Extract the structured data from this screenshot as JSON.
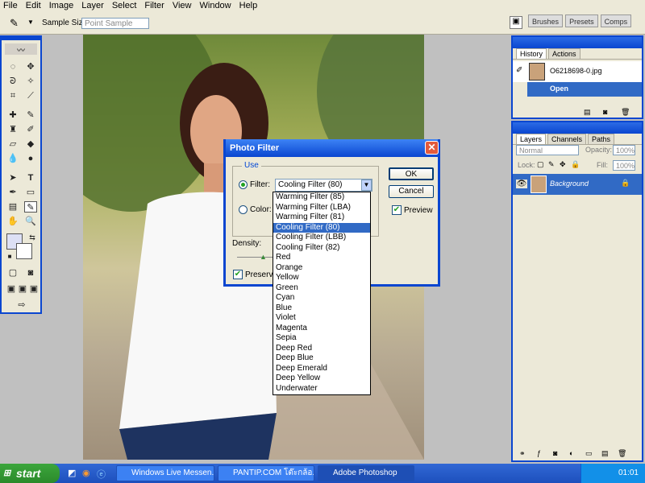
{
  "menu": [
    "File",
    "Edit",
    "Image",
    "Layer",
    "Select",
    "Filter",
    "View",
    "Window",
    "Help"
  ],
  "options": {
    "sample_size_label": "Sample Size:",
    "sample_size_value": "Point Sample"
  },
  "panel_well": {
    "tabs": [
      "Brushes",
      "Presets",
      "Comps"
    ]
  },
  "history_panel": {
    "tabs": [
      "History",
      "Actions"
    ],
    "snapshot_name": "O6218698-0.jpg",
    "state": "Open"
  },
  "layers_panel": {
    "tabs": [
      "Layers",
      "Channels",
      "Paths"
    ],
    "blend_mode": "Normal",
    "opacity_label": "Opacity:",
    "opacity_value": "100%",
    "lock_label": "Lock:",
    "fill_label": "Fill:",
    "fill_value": "100%",
    "layer_name": "Background"
  },
  "dialog": {
    "title": "Photo Filter",
    "use_label": "Use",
    "filter_label": "Filter:",
    "filter_value": "Cooling Filter (80)",
    "color_label": "Color:",
    "density_label": "Density:",
    "preserve_label": "Preserve",
    "ok": "OK",
    "cancel": "Cancel",
    "preview": "Preview",
    "filter_options": [
      "Warming Filter (85)",
      "Warming Filter (LBA)",
      "Warming Filter (81)",
      "Cooling Filter (80)",
      "Cooling Filter (LBB)",
      "Cooling Filter (82)",
      "Red",
      "Orange",
      "Yellow",
      "Green",
      "Cyan",
      "Blue",
      "Violet",
      "Magenta",
      "Sepia",
      "Deep Red",
      "Deep Blue",
      "Deep Emerald",
      "Deep Yellow",
      "Underwater"
    ],
    "selected_index": 3
  },
  "taskbar": {
    "start": "start",
    "items": [
      "Windows Live Messen...",
      "PANTIP.COM โต๊ะกล้อ...",
      "Adobe Photoshop"
    ],
    "clock": "01:01"
  }
}
